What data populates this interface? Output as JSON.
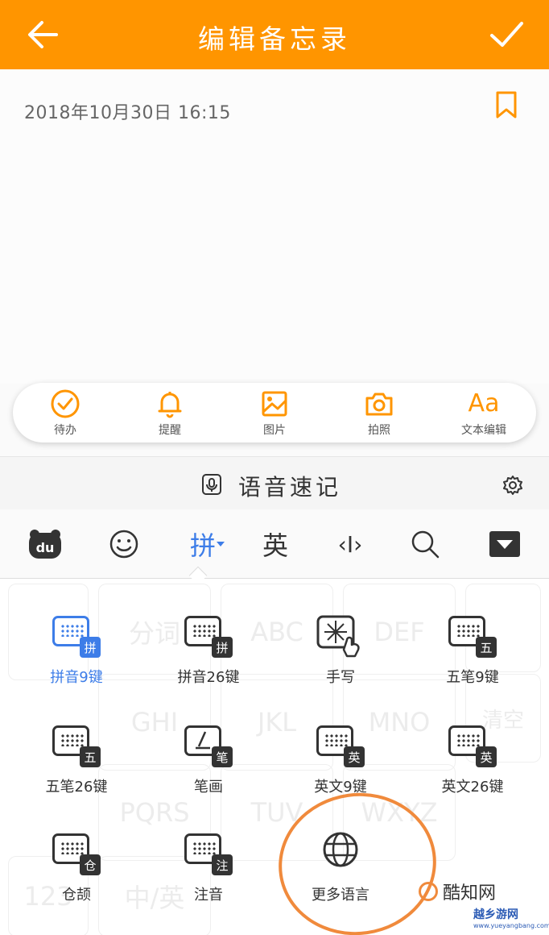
{
  "header": {
    "title": "编辑备忘录",
    "back_icon": "arrow-left-icon",
    "confirm_icon": "check-icon",
    "bg_color": "#ff9500"
  },
  "note": {
    "date_time": "2018年10月30日  16:15",
    "bookmark_icon": "bookmark-icon"
  },
  "toolbar": {
    "items": [
      {
        "label": "待办",
        "icon": "check-circle-icon"
      },
      {
        "label": "提醒",
        "icon": "bell-icon"
      },
      {
        "label": "图片",
        "icon": "image-icon"
      },
      {
        "label": "拍照",
        "icon": "camera-icon"
      },
      {
        "label": "文本编辑",
        "icon_text": "Aa"
      }
    ]
  },
  "voice": {
    "label": "语音速记",
    "mic_icon": "microphone-icon",
    "settings_icon": "gear-icon"
  },
  "keyboard_top": {
    "logo_text": "du",
    "pinyin_label": "拼",
    "english_label": "英",
    "cursor_label": "‹I›"
  },
  "input_methods": [
    {
      "label": "拼音9键",
      "badge": "拼",
      "selected": true
    },
    {
      "label": "拼音26键",
      "badge": "拼"
    },
    {
      "label": "手写"
    },
    {
      "label": "五笔9键",
      "badge": "五"
    },
    {
      "label": "五笔26键",
      "badge": "五"
    },
    {
      "label": "笔画",
      "badge": "笔"
    },
    {
      "label": "英文9键",
      "badge": "英"
    },
    {
      "label": "英文26键",
      "badge": "英"
    },
    {
      "label": "仓颉",
      "badge": "仓"
    },
    {
      "label": "注音",
      "badge": "注"
    },
    {
      "label": "更多语言"
    }
  ],
  "background_keys": [
    "分词",
    "ABC",
    "DEF",
    "GHI",
    "JKL",
    "MNO",
    "清空",
    "PQRS",
    "TUV",
    "WXYZ",
    "123",
    "中/英"
  ],
  "watermark": {
    "site1": "酷知网",
    "site2": "越乡游网",
    "url": "www.yueyangbang.com"
  }
}
